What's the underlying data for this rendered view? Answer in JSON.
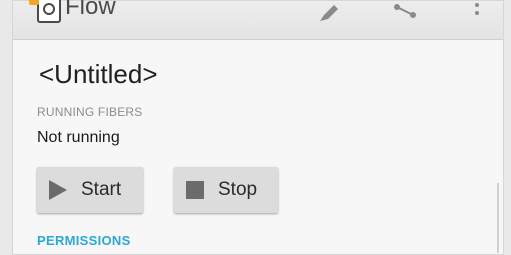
{
  "app": {
    "title": "Flow"
  },
  "document": {
    "title": "<Untitled>"
  },
  "running_fibers": {
    "section_label": "RUNNING FIBERS",
    "status": "Not running"
  },
  "controls": {
    "start_label": "Start",
    "stop_label": "Stop"
  },
  "permissions": {
    "section_label": "PERMISSIONS"
  },
  "icons": {
    "edit": "pen-icon",
    "share": "share-icon",
    "more": "more-vert-icon"
  },
  "colors": {
    "accent": "#2aa8d6",
    "logo": "#f5a623"
  }
}
